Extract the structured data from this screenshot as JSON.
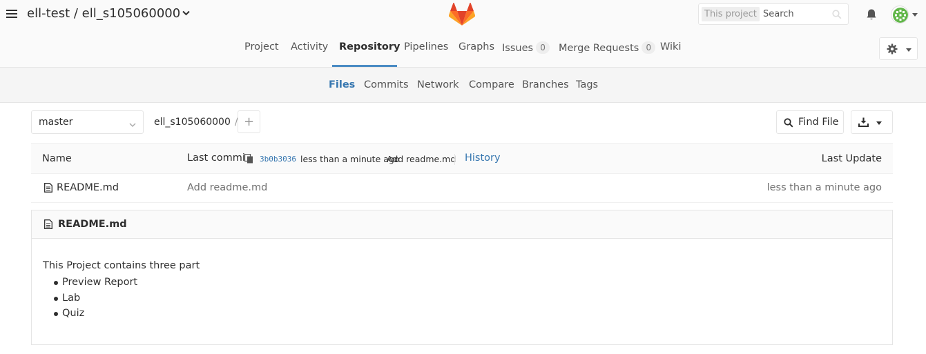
{
  "header": {
    "group": "ell-test",
    "separator": " / ",
    "project": "ell_s105060000",
    "search_scope": "This project",
    "search_placeholder": "Search"
  },
  "nav": {
    "items": [
      {
        "label": "Project"
      },
      {
        "label": "Activity"
      },
      {
        "label": "Repository",
        "active": true
      },
      {
        "label": "Pipelines"
      },
      {
        "label": "Graphs"
      },
      {
        "label": "Issues",
        "count": "0"
      },
      {
        "label": "Merge Requests",
        "count": "0"
      },
      {
        "label": "Wiki"
      }
    ]
  },
  "subnav": {
    "items": [
      {
        "label": "Files",
        "active": true
      },
      {
        "label": "Commits"
      },
      {
        "label": "Network"
      },
      {
        "label": "Compare"
      },
      {
        "label": "Branches"
      },
      {
        "label": "Tags"
      }
    ]
  },
  "toolbar": {
    "branch": "master",
    "path_root": "ell_s105060000",
    "path_sep": "/",
    "add_label": "+",
    "find_file_label": "Find File"
  },
  "table": {
    "col_name": "Name",
    "col_last_commit": "Last commit",
    "commit_sha": "3b0b3036",
    "commit_time": "less than a minute ago",
    "commit_message": "Add readme.md",
    "history_label": "History",
    "col_last_update": "Last Update",
    "rows": [
      {
        "name": "README.md",
        "message": "Add readme.md",
        "updated": "less than a minute ago"
      }
    ]
  },
  "readme": {
    "title": "README.md",
    "paragraph": "This Project contains three part",
    "bullets": [
      "Preview Report",
      "Lab",
      "Quiz"
    ]
  },
  "colors": {
    "accent": "#4a8bc4",
    "link": "#3777b0"
  },
  "icons": [
    "hamburger-icon",
    "chevron-down-icon",
    "gitlab-logo-icon",
    "search-icon",
    "bell-icon",
    "avatar",
    "gear-icon",
    "plus-icon",
    "download-icon",
    "copy-icon",
    "file-icon"
  ]
}
